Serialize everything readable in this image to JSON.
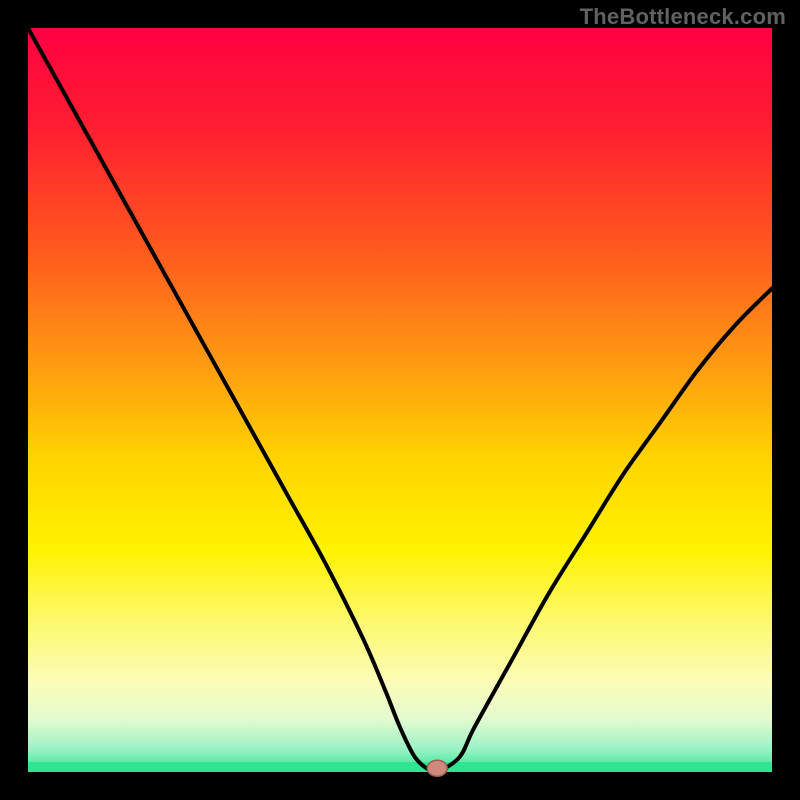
{
  "watermark": "TheBottleneck.com",
  "chart_data": {
    "type": "line",
    "title": "",
    "xlabel": "",
    "ylabel": "",
    "xlim": [
      0,
      100
    ],
    "ylim": [
      0,
      100
    ],
    "x": [
      0,
      5,
      10,
      15,
      20,
      25,
      30,
      35,
      40,
      45,
      48,
      50,
      52,
      54,
      55,
      58,
      60,
      65,
      70,
      75,
      80,
      85,
      90,
      95,
      100
    ],
    "values": [
      100,
      91,
      82,
      73,
      64,
      55,
      46,
      37,
      28,
      18,
      11,
      6,
      2,
      0.2,
      0,
      2,
      6,
      15,
      24,
      32,
      40,
      47,
      54,
      60,
      65
    ],
    "gradient_stops": [
      {
        "offset": 0.0,
        "color": "#ff0042"
      },
      {
        "offset": 0.14,
        "color": "#ff2030"
      },
      {
        "offset": 0.3,
        "color": "#ff5a1e"
      },
      {
        "offset": 0.45,
        "color": "#ff9a12"
      },
      {
        "offset": 0.58,
        "color": "#ffd400"
      },
      {
        "offset": 0.7,
        "color": "#fff200"
      },
      {
        "offset": 0.8,
        "color": "#fdf970"
      },
      {
        "offset": 0.88,
        "color": "#fbfcb8"
      },
      {
        "offset": 0.93,
        "color": "#e2fbd0"
      },
      {
        "offset": 0.97,
        "color": "#98f2c4"
      },
      {
        "offset": 1.0,
        "color": "#2fe592"
      }
    ],
    "marker": {
      "x": 55,
      "y": 0.5,
      "color": "#cf8a7b",
      "outline": "#9a5e52"
    },
    "bottom_band_color": "#2fe592",
    "plot_bg_left": 28,
    "plot_bg_top": 28,
    "plot_bg_width": 744,
    "plot_bg_height": 744
  }
}
